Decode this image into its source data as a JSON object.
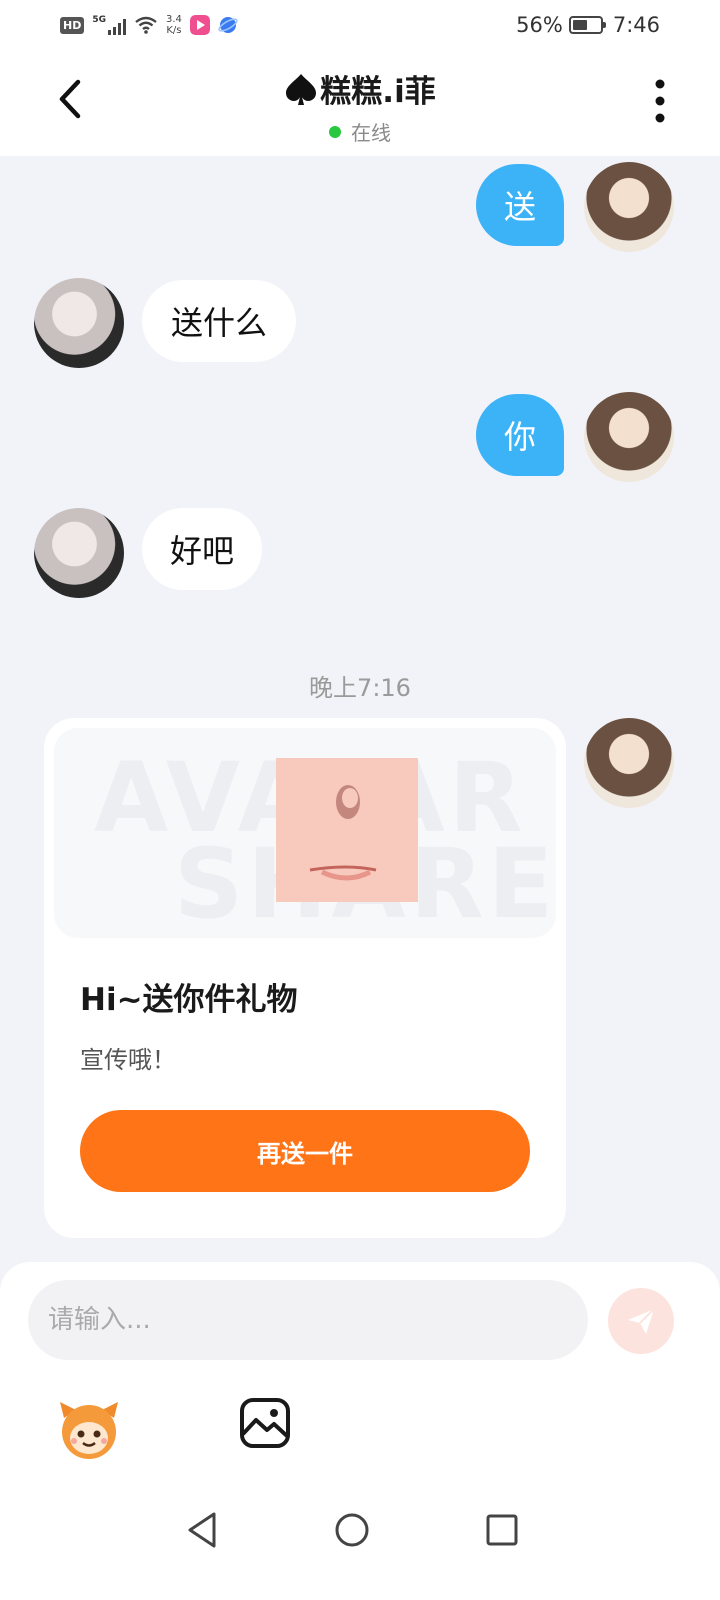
{
  "status_bar": {
    "network_badge": "HD",
    "signal_label": "5G",
    "speed_value": "3.4",
    "speed_unit": "K/s",
    "battery_percent": "56%",
    "battery_level": 0.56,
    "time": "7:46"
  },
  "header": {
    "title": "糕糕.i菲",
    "title_prefix_icon": "spade-icon",
    "presence": "在线",
    "presence_color": "#28c840"
  },
  "messages": [
    {
      "sender": "me",
      "text": "送"
    },
    {
      "sender": "peer",
      "text": "送什么"
    },
    {
      "sender": "me",
      "text": "你"
    },
    {
      "sender": "peer",
      "text": "好吧"
    }
  ],
  "timestamp": "晚上7:16",
  "gift_card": {
    "watermark_line1": "AVATAR",
    "watermark_line2": "SHARE",
    "title": "Hi~送你件礼物",
    "subtitle": "宣传哦！",
    "button_label": "再送一件",
    "button_color": "#ff7416"
  },
  "composer": {
    "placeholder": "请输入...",
    "send_icon": "send-icon",
    "toolbar": [
      "emoji-sticker-icon",
      "image-icon"
    ]
  },
  "nav_bar": [
    "back-triangle-icon",
    "home-circle-icon",
    "recents-square-icon"
  ],
  "colors": {
    "my_bubble": "#3cb3f7",
    "accent_orange": "#ff7416",
    "background": "#f2f3f8"
  }
}
